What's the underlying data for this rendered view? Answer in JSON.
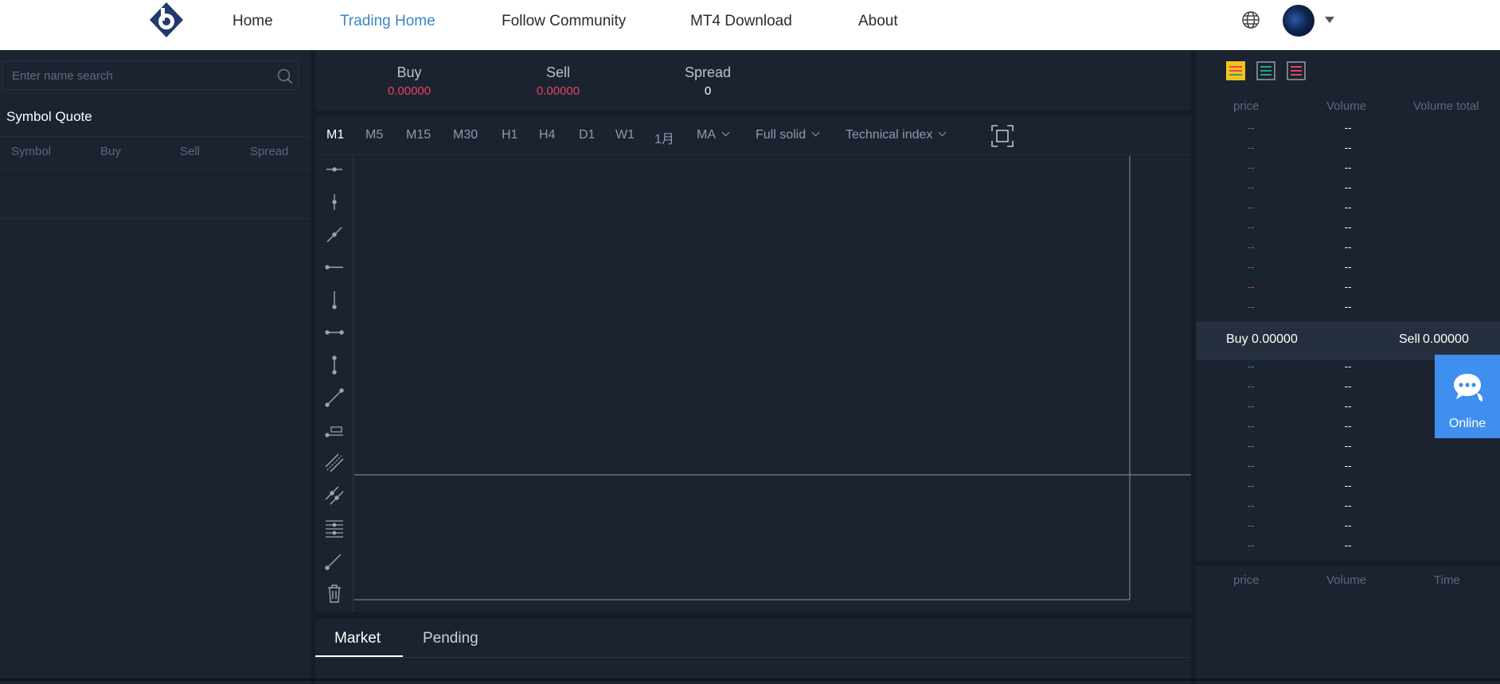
{
  "nav": {
    "items": [
      "Home",
      "Trading Home",
      "Follow Community",
      "MT4 Download",
      "About"
    ],
    "active_index": 1
  },
  "left": {
    "search_placeholder": "Enter name search",
    "title": "Symbol Quote",
    "columns": [
      "Symbol",
      "Buy",
      "Sell",
      "Spread"
    ]
  },
  "quote_bar": {
    "buy_label": "Buy",
    "buy_value": "0.00000",
    "sell_label": "Sell",
    "sell_value": "0.00000",
    "spread_label": "Spread",
    "spread_value": "0"
  },
  "chart_toolbar": {
    "timeframes": [
      "M1",
      "M5",
      "M15",
      "M30",
      "H1",
      "H4",
      "D1",
      "W1",
      "1月"
    ],
    "active_timeframe": "M1",
    "indicator_dropdown": "MA",
    "style_dropdown": "Full solid",
    "technical_dropdown": "Technical index"
  },
  "drawing_tools": [
    "horizontal-ray-icon",
    "vertical-segment-icon",
    "trend-line-icon",
    "horizontal-line-icon",
    "vertical-line-icon",
    "horizontal-segment-icon",
    "vertical-range-icon",
    "segment-icon",
    "price-label-icon",
    "parallel-channel-icon",
    "parallel-lines-icon",
    "fibonacci-icon",
    "ray-icon",
    "trash-icon"
  ],
  "bottom_tabs": {
    "market": "Market",
    "pending": "Pending"
  },
  "orderbook": {
    "columns": [
      "price",
      "Volume",
      "Volume total"
    ],
    "ask_rows": [
      "--",
      "--",
      "--",
      "--",
      "--",
      "--",
      "--",
      "--",
      "--",
      "--"
    ],
    "bid_rows": [
      "--",
      "--",
      "--",
      "--",
      "--",
      "--",
      "--",
      "--",
      "--",
      "--"
    ],
    "mid_buy_label": "Buy",
    "mid_buy_value": "0.00000",
    "mid_sell_label": "Sell",
    "mid_sell_value": "0.00000",
    "colors": {
      "ask": "#b8485a",
      "bid": "#2e9c86",
      "view_all": "#f2c318",
      "view_bids": "#2e9c86",
      "view_asks": "#e8435a"
    }
  },
  "trades": {
    "columns": [
      "price",
      "Volume",
      "Time"
    ]
  },
  "online": {
    "label": "Online"
  },
  "colors": {
    "accent": "#3b86c6",
    "up_red": "#e8435a",
    "bg": "#1b2331",
    "online_bg": "#3f8ff0"
  }
}
